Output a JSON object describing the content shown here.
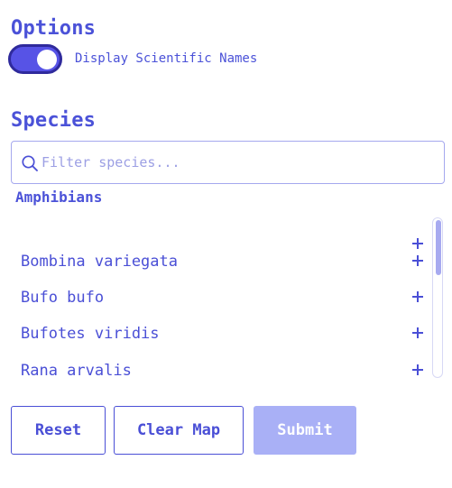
{
  "options": {
    "title": "Options",
    "toggle_label": "Display Scientific Names",
    "toggle_on": true
  },
  "species": {
    "title": "Species",
    "search_placeholder": "Filter species...",
    "search_value": "",
    "group": "Amphibians",
    "items": [
      {
        "name": ""
      },
      {
        "name": "Bombina variegata"
      },
      {
        "name": "Bufo bufo"
      },
      {
        "name": "Bufotes viridis"
      },
      {
        "name": "Rana arvalis"
      }
    ]
  },
  "actions": {
    "reset": "Reset",
    "clear_map": "Clear Map",
    "submit": "Submit"
  },
  "colors": {
    "accent": "#4a4fd6",
    "toggle_bg": "#5753e6",
    "submit_disabled": "#a9b0f6"
  },
  "icons": {
    "search": "search-icon",
    "add": "plus-icon"
  }
}
